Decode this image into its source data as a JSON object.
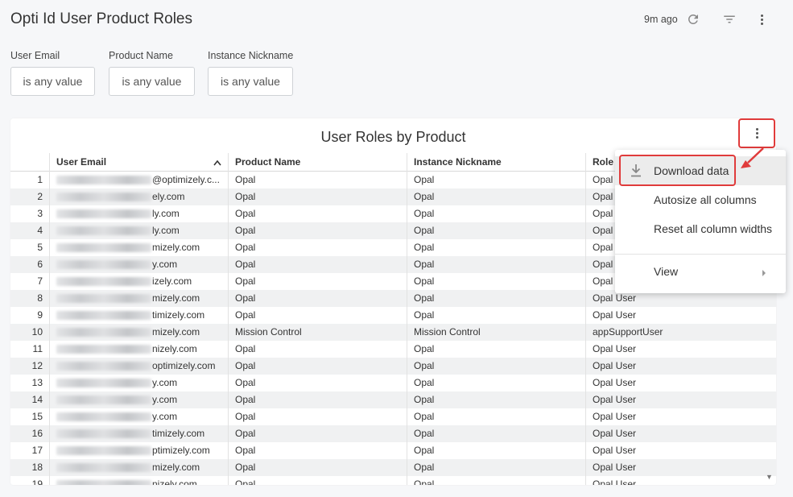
{
  "header": {
    "title": "Opti Id User Product Roles",
    "updated": "9m ago",
    "icons": [
      "refresh-icon",
      "filter-icon",
      "more-vert-icon"
    ]
  },
  "filters": [
    {
      "label": "User Email",
      "value": "is any value"
    },
    {
      "label": "Product Name",
      "value": "is any value"
    },
    {
      "label": "Instance Nickname",
      "value": "is any value"
    }
  ],
  "tile": {
    "title": "User Roles by Product",
    "columns": [
      "User Email",
      "Product Name",
      "Instance Nickname",
      "Role I"
    ],
    "sort_icon": "^",
    "rows": [
      {
        "n": "1",
        "email": "@optimizely.c...",
        "product": "Opal",
        "instance": "Opal",
        "role": "Opal"
      },
      {
        "n": "2",
        "email": "ely.com",
        "product": "Opal",
        "instance": "Opal",
        "role": "Opal"
      },
      {
        "n": "3",
        "email": "ly.com",
        "product": "Opal",
        "instance": "Opal",
        "role": "Opal"
      },
      {
        "n": "4",
        "email": "ly.com",
        "product": "Opal",
        "instance": "Opal",
        "role": "Opal"
      },
      {
        "n": "5",
        "email": "mizely.com",
        "product": "Opal",
        "instance": "Opal",
        "role": "Opal"
      },
      {
        "n": "6",
        "email": "y.com",
        "product": "Opal",
        "instance": "Opal",
        "role": "Opal"
      },
      {
        "n": "7",
        "email": "izely.com",
        "product": "Opal",
        "instance": "Opal",
        "role": "Opal"
      },
      {
        "n": "8",
        "email": "mizely.com",
        "product": "Opal",
        "instance": "Opal",
        "role": "Opal User"
      },
      {
        "n": "9",
        "email": "timizely.com",
        "product": "Opal",
        "instance": "Opal",
        "role": "Opal User"
      },
      {
        "n": "10",
        "email": "mizely.com",
        "product": "Mission Control",
        "instance": "Mission Control",
        "role": "appSupportUser"
      },
      {
        "n": "11",
        "email": "nizely.com",
        "product": "Opal",
        "instance": "Opal",
        "role": "Opal User"
      },
      {
        "n": "12",
        "email": "optimizely.com",
        "product": "Opal",
        "instance": "Opal",
        "role": "Opal User"
      },
      {
        "n": "13",
        "email": "y.com",
        "product": "Opal",
        "instance": "Opal",
        "role": "Opal User"
      },
      {
        "n": "14",
        "email": "y.com",
        "product": "Opal",
        "instance": "Opal",
        "role": "Opal User"
      },
      {
        "n": "15",
        "email": "y.com",
        "product": "Opal",
        "instance": "Opal",
        "role": "Opal User"
      },
      {
        "n": "16",
        "email": "timizely.com",
        "product": "Opal",
        "instance": "Opal",
        "role": "Opal User"
      },
      {
        "n": "17",
        "email": "ptimizely.com",
        "product": "Opal",
        "instance": "Opal",
        "role": "Opal User"
      },
      {
        "n": "18",
        "email": "mizely.com",
        "product": "Opal",
        "instance": "Opal",
        "role": "Opal User"
      },
      {
        "n": "19",
        "email": "nizely.com",
        "product": "Opal",
        "instance": "Opal",
        "role": "Opal User"
      }
    ]
  },
  "menu": {
    "items": [
      {
        "label": "Download data",
        "icon": "download-icon"
      },
      {
        "label": "Autosize all columns"
      },
      {
        "label": "Reset all column widths"
      },
      {
        "label": "View",
        "icon": "chevron-right-icon"
      }
    ]
  },
  "colors": {
    "highlight": "#e03b3b",
    "row_alt": "#f0f1f2"
  }
}
